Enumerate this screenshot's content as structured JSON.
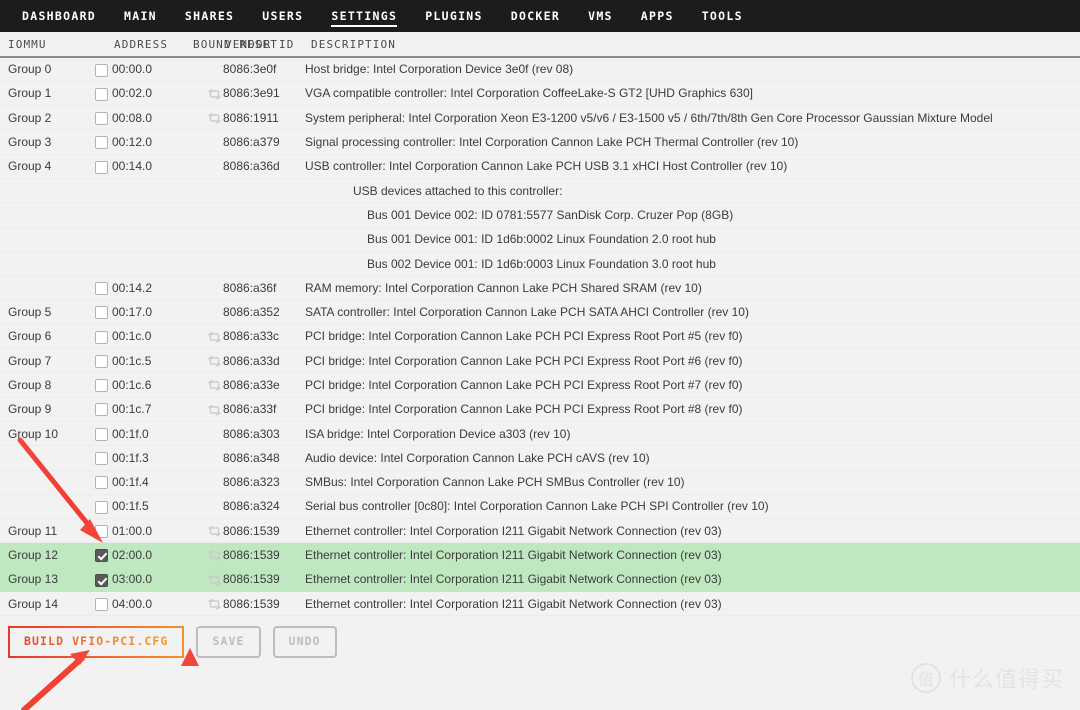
{
  "nav": {
    "items": [
      {
        "label": "DASHBOARD",
        "active": false
      },
      {
        "label": "MAIN",
        "active": false
      },
      {
        "label": "SHARES",
        "active": false
      },
      {
        "label": "USERS",
        "active": false
      },
      {
        "label": "SETTINGS",
        "active": true
      },
      {
        "label": "PLUGINS",
        "active": false
      },
      {
        "label": "DOCKER",
        "active": false
      },
      {
        "label": "VMS",
        "active": false
      },
      {
        "label": "APPS",
        "active": false
      },
      {
        "label": "TOOLS",
        "active": false
      }
    ]
  },
  "table": {
    "headers": {
      "group": "IOMMU",
      "address": "ADDRESS",
      "bound_reset": "BOUND RESET",
      "vendor": "VENDOR ID",
      "description": "DESCRIPTION"
    },
    "rows": [
      {
        "group": "Group 0",
        "checked": false,
        "address": "00:00.0",
        "reset": false,
        "vendor": "8086:3e0f",
        "description": "Host bridge: Intel Corporation Device 3e0f (rev 08)",
        "selected": false,
        "indent": 0
      },
      {
        "group": "Group 1",
        "checked": false,
        "address": "00:02.0",
        "reset": true,
        "vendor": "8086:3e91",
        "description": "VGA compatible controller: Intel Corporation CoffeeLake-S GT2 [UHD Graphics 630]",
        "selected": false,
        "indent": 0
      },
      {
        "group": "Group 2",
        "checked": false,
        "address": "00:08.0",
        "reset": true,
        "vendor": "8086:1911",
        "description": "System peripheral: Intel Corporation Xeon E3-1200 v5/v6 / E3-1500 v5 / 6th/7th/8th Gen Core Processor Gaussian Mixture Model",
        "selected": false,
        "indent": 0
      },
      {
        "group": "Group 3",
        "checked": false,
        "address": "00:12.0",
        "reset": false,
        "vendor": "8086:a379",
        "description": "Signal processing controller: Intel Corporation Cannon Lake PCH Thermal Controller (rev 10)",
        "selected": false,
        "indent": 0
      },
      {
        "group": "Group 4",
        "checked": false,
        "address": "00:14.0",
        "reset": false,
        "vendor": "8086:a36d",
        "description": "USB controller: Intel Corporation Cannon Lake PCH USB 3.1 xHCI Host Controller (rev 10)",
        "selected": false,
        "indent": 0
      },
      {
        "group": "",
        "checked": null,
        "address": "",
        "reset": false,
        "vendor": "",
        "description": "USB devices attached to this controller:",
        "selected": false,
        "indent": 1
      },
      {
        "group": "",
        "checked": null,
        "address": "",
        "reset": false,
        "vendor": "",
        "description": "Bus 001 Device 002: ID 0781:5577 SanDisk Corp. Cruzer Pop (8GB)",
        "selected": false,
        "indent": 2
      },
      {
        "group": "",
        "checked": null,
        "address": "",
        "reset": false,
        "vendor": "",
        "description": "Bus 001 Device 001: ID 1d6b:0002 Linux Foundation 2.0 root hub",
        "selected": false,
        "indent": 2
      },
      {
        "group": "",
        "checked": null,
        "address": "",
        "reset": false,
        "vendor": "",
        "description": "Bus 002 Device 001: ID 1d6b:0003 Linux Foundation 3.0 root hub",
        "selected": false,
        "indent": 2
      },
      {
        "group": "",
        "checked": false,
        "address": "00:14.2",
        "reset": false,
        "vendor": "8086:a36f",
        "description": "RAM memory: Intel Corporation Cannon Lake PCH Shared SRAM (rev 10)",
        "selected": false,
        "indent": 0
      },
      {
        "group": "Group 5",
        "checked": false,
        "address": "00:17.0",
        "reset": false,
        "vendor": "8086:a352",
        "description": "SATA controller: Intel Corporation Cannon Lake PCH SATA AHCI Controller (rev 10)",
        "selected": false,
        "indent": 0
      },
      {
        "group": "Group 6",
        "checked": false,
        "address": "00:1c.0",
        "reset": true,
        "vendor": "8086:a33c",
        "description": "PCI bridge: Intel Corporation Cannon Lake PCH PCI Express Root Port #5 (rev f0)",
        "selected": false,
        "indent": 0
      },
      {
        "group": "Group 7",
        "checked": false,
        "address": "00:1c.5",
        "reset": true,
        "vendor": "8086:a33d",
        "description": "PCI bridge: Intel Corporation Cannon Lake PCH PCI Express Root Port #6 (rev f0)",
        "selected": false,
        "indent": 0
      },
      {
        "group": "Group 8",
        "checked": false,
        "address": "00:1c.6",
        "reset": true,
        "vendor": "8086:a33e",
        "description": "PCI bridge: Intel Corporation Cannon Lake PCH PCI Express Root Port #7 (rev f0)",
        "selected": false,
        "indent": 0
      },
      {
        "group": "Group 9",
        "checked": false,
        "address": "00:1c.7",
        "reset": true,
        "vendor": "8086:a33f",
        "description": "PCI bridge: Intel Corporation Cannon Lake PCH PCI Express Root Port #8 (rev f0)",
        "selected": false,
        "indent": 0
      },
      {
        "group": "Group 10",
        "checked": false,
        "address": "00:1f.0",
        "reset": false,
        "vendor": "8086:a303",
        "description": "ISA bridge: Intel Corporation Device a303 (rev 10)",
        "selected": false,
        "indent": 0
      },
      {
        "group": "",
        "checked": false,
        "address": "00:1f.3",
        "reset": false,
        "vendor": "8086:a348",
        "description": "Audio device: Intel Corporation Cannon Lake PCH cAVS (rev 10)",
        "selected": false,
        "indent": 0
      },
      {
        "group": "",
        "checked": false,
        "address": "00:1f.4",
        "reset": false,
        "vendor": "8086:a323",
        "description": "SMBus: Intel Corporation Cannon Lake PCH SMBus Controller (rev 10)",
        "selected": false,
        "indent": 0
      },
      {
        "group": "",
        "checked": false,
        "address": "00:1f.5",
        "reset": false,
        "vendor": "8086:a324",
        "description": "Serial bus controller [0c80]: Intel Corporation Cannon Lake PCH SPI Controller (rev 10)",
        "selected": false,
        "indent": 0
      },
      {
        "group": "Group 11",
        "checked": false,
        "address": "01:00.0",
        "reset": true,
        "vendor": "8086:1539",
        "description": "Ethernet controller: Intel Corporation I211 Gigabit Network Connection (rev 03)",
        "selected": false,
        "indent": 0
      },
      {
        "group": "Group 12",
        "checked": true,
        "address": "02:00.0",
        "reset": true,
        "vendor": "8086:1539",
        "description": "Ethernet controller: Intel Corporation I211 Gigabit Network Connection (rev 03)",
        "selected": true,
        "indent": 0
      },
      {
        "group": "Group 13",
        "checked": true,
        "address": "03:00.0",
        "reset": true,
        "vendor": "8086:1539",
        "description": "Ethernet controller: Intel Corporation I211 Gigabit Network Connection (rev 03)",
        "selected": true,
        "indent": 0
      },
      {
        "group": "Group 14",
        "checked": false,
        "address": "04:00.0",
        "reset": true,
        "vendor": "8086:1539",
        "description": "Ethernet controller: Intel Corporation I211 Gigabit Network Connection (rev 03)",
        "selected": false,
        "indent": 0
      }
    ]
  },
  "buttons": {
    "build": "BUILD VFIO-PCI.CFG",
    "save": "SAVE",
    "undo": "UNDO"
  },
  "watermark": {
    "mark": "值",
    "text": "什么值得买"
  },
  "colors": {
    "nav_bg": "#1c1c1c",
    "page_bg": "#f2f2f2",
    "selected_row": "#bfe8c0",
    "accent_build": "#f0802c",
    "annotation_arrow": "#f4453a",
    "checkbox_checked": "#5a5a5a"
  },
  "icons": {
    "reset": "reset-icon",
    "checkbox": "checkbox-icon"
  }
}
